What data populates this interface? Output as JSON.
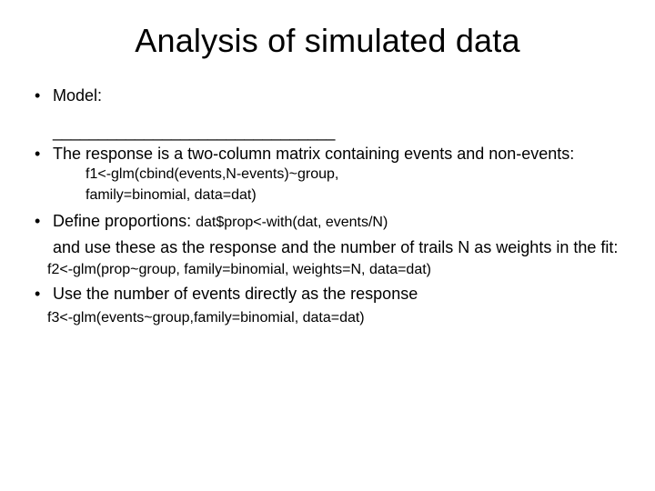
{
  "title": "Analysis of simulated data",
  "bullets": {
    "b1_label": "Model:",
    "blank_line": "_______________________________",
    "b2_text": "The response is a two-column matrix containing events and non-events:",
    "b2_code1": "f1<-glm(cbind(events,N-events)~group,",
    "b2_code2": "family=binomial, data=dat)",
    "b3_lead": "Define proportions: ",
    "b3_code": "dat$prop<-with(dat, events/N)",
    "b3_tail": "and use these as the response and the number of trails N as weights in the fit:",
    "b3_code2": "f2<-glm(prop~group, family=binomial, weights=N, data=dat)",
    "b4_text": "Use the number of events directly as the response",
    "b4_code": "f3<-glm(events~group,family=binomial, data=dat)"
  }
}
